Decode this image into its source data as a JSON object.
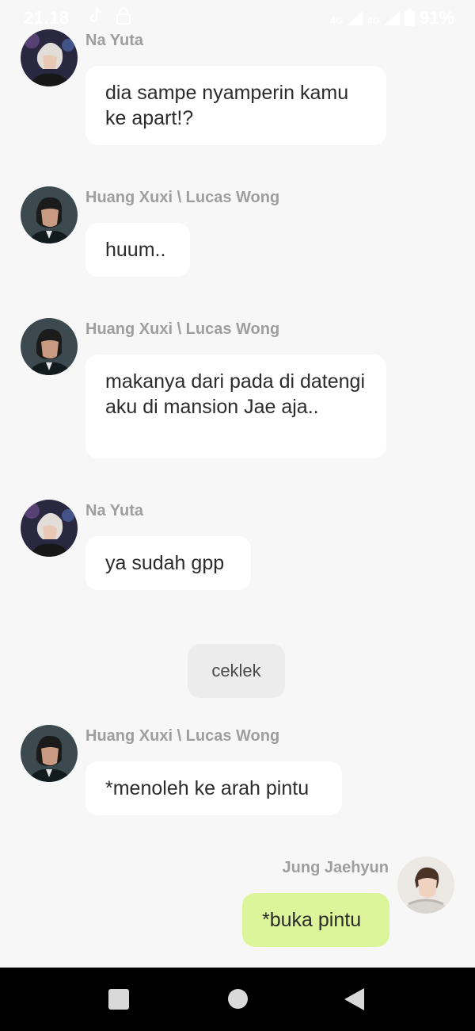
{
  "status_bar": {
    "time": "21.18",
    "network_1": "4G",
    "network_2": "4G",
    "battery": "91%",
    "icons": [
      "tiktok-icon",
      "lock-icon",
      "signal-icon",
      "battery-icon"
    ]
  },
  "chat": {
    "messages": [
      {
        "sender": "Na Yuta",
        "text": "dia sampe nyamperin kamu ke apart!?",
        "avatar": "avatar-na-yuta"
      },
      {
        "sender": "Huang Xuxi \\ Lucas Wong",
        "text": "huum..",
        "avatar": "avatar-lucas"
      },
      {
        "sender": "Huang Xuxi \\ Lucas Wong",
        "text": "makanya dari pada di datengi aku di mansion Jae aja..",
        "avatar": "avatar-lucas"
      },
      {
        "sender": "Na Yuta",
        "text": "ya sudah gpp",
        "avatar": "avatar-na-yuta"
      },
      {
        "system": "ceklek"
      },
      {
        "sender": "Huang Xuxi \\ Lucas Wong",
        "text": "*menoleh ke arah pintu",
        "avatar": "avatar-lucas"
      },
      {
        "sender": "Jung Jaehyun",
        "text": "*buka pintu",
        "avatar": "avatar-jaehyun",
        "own": true
      }
    ]
  },
  "colors": {
    "background": "#f7f7f7",
    "bubble": "#ffffff",
    "own_bubble": "#dcf59a",
    "system_bubble": "#ececec",
    "sender_text": "#9e9e9e",
    "nav_bar": "#000000"
  },
  "nav_bar": {
    "icons": [
      "recents-square-icon",
      "home-circle-icon",
      "back-triangle-icon"
    ]
  }
}
